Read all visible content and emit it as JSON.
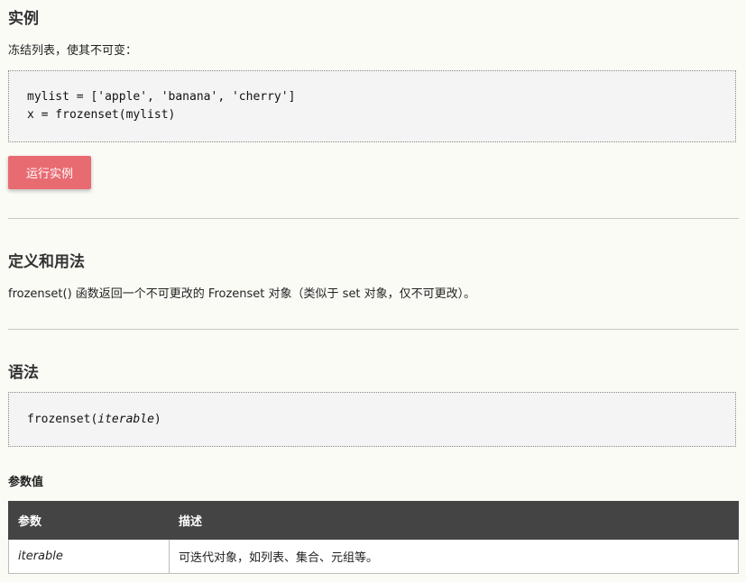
{
  "example": {
    "title": "实例",
    "description": "冻结列表，使其不可变：",
    "code_lines": [
      "mylist = ['apple', 'banana', 'cherry']",
      "x = frozenset(mylist)"
    ],
    "run_button_label": "运行实例"
  },
  "definition": {
    "title": "定义和用法",
    "text": "frozenset() 函数返回一个不可更改的 Frozenset 对象（类似于 set 对象，仅不可更改）。"
  },
  "syntax": {
    "title": "语法",
    "code_prefix": "frozenset(",
    "code_param": "iterable",
    "code_suffix": ")"
  },
  "parameters": {
    "title": "参数值",
    "headers": [
      "参数",
      "描述"
    ],
    "rows": [
      {
        "name": "iterable",
        "description": "可迭代对象，如列表、集合、元组等。"
      }
    ]
  },
  "colors": {
    "button": "#e96b72",
    "table_header": "#444444",
    "background": "#fbfbf6"
  }
}
